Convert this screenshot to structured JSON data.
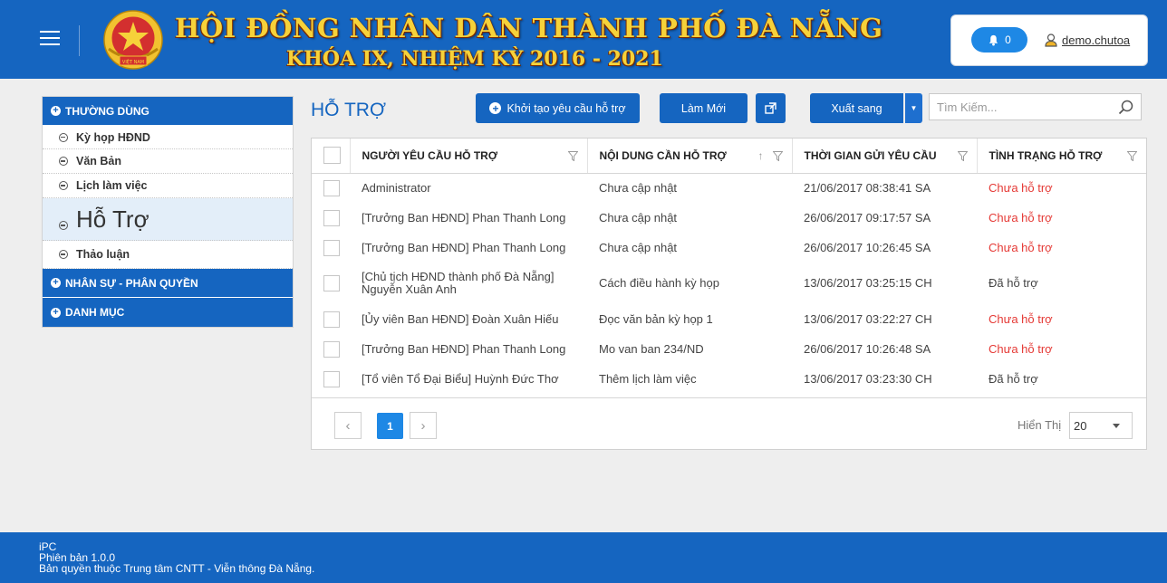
{
  "header": {
    "title_line1": "HỘI ĐỒNG NHÂN DÂN THÀNH PHỐ ĐÀ NẴNG",
    "title_line2": "KHÓA IX, NHIỆM KỲ 2016 - 2021",
    "notification_count": "0",
    "username": "demo.chutoa",
    "emblem_text": "VIỆT NAM"
  },
  "sidebar": {
    "sections": [
      {
        "label": "THƯỜNG DÙNG"
      },
      {
        "label": "NHÂN SỰ - PHÂN QUYỀN"
      },
      {
        "label": "DANH MỤC"
      }
    ],
    "items": [
      {
        "label": "Kỳ họp HĐND"
      },
      {
        "label": "Văn Bản"
      },
      {
        "label": "Lịch làm việc"
      },
      {
        "label": "Hỗ Trợ"
      },
      {
        "label": "Thảo luận"
      }
    ]
  },
  "main": {
    "title": "HỖ TRỢ",
    "create_label": "Khởi tạo yêu cầu hỗ trợ",
    "refresh_label": "Làm Mới",
    "export_label": "Xuất sang",
    "search_placeholder": "Tìm Kiếm..."
  },
  "table": {
    "columns": [
      "NGƯỜI YÊU CẦU HỖ TRỢ",
      "NỘI DUNG CẦN HỖ TRỢ",
      "THỜI GIAN GỬI YÊU CẦU",
      "TÌNH TRẠNG HỖ TRỢ"
    ],
    "rows": [
      {
        "requester": "Administrator",
        "content": "Chưa cập nhật",
        "time": "21/06/2017 08:38:41 SA",
        "status": "Chưa hỗ trợ"
      },
      {
        "requester": "[Trưởng Ban HĐND] Phan Thanh Long",
        "content": "Chưa cập nhật",
        "time": "26/06/2017 09:17:57 SA",
        "status": "Chưa hỗ trợ"
      },
      {
        "requester": "[Trưởng Ban HĐND] Phan Thanh Long",
        "content": "Chưa cập nhật",
        "time": "26/06/2017 10:26:45 SA",
        "status": "Chưa hỗ trợ"
      },
      {
        "requester": "[Chủ tịch HĐND thành phố Đà Nẵng] Nguyễn Xuân Anh",
        "content": "Cách điều hành kỳ họp",
        "time": "13/06/2017 03:25:15 CH",
        "status": "Đã hỗ trợ"
      },
      {
        "requester": "[Ủy viên Ban HĐND] Đoàn Xuân Hiếu",
        "content": "Đọc văn bản kỳ họp 1",
        "time": "13/06/2017 03:22:27 CH",
        "status": "Chưa hỗ trợ"
      },
      {
        "requester": "[Trưởng Ban HĐND] Phan Thanh Long",
        "content": "Mo van ban 234/ND",
        "time": "26/06/2017 10:26:48 SA",
        "status": "Chưa hỗ trợ"
      },
      {
        "requester": "[Tổ viên Tổ Đại Biểu] Huỳnh Đức Thơ",
        "content": "Thêm lịch làm việc",
        "time": "13/06/2017 03:23:30 CH",
        "status": "Đã hỗ trợ"
      }
    ],
    "status_colors": {
      "pending": "#e53935",
      "done": "#444444"
    }
  },
  "pager": {
    "current_page": "1",
    "show_label": "Hiển Thị",
    "page_size": "20"
  },
  "footer": {
    "line1": "iPC",
    "line2": "Phiên bản 1.0.0",
    "line3": "Bản quyền thuộc Trung tâm CNTT - Viễn thông Đà Nẵng."
  },
  "colors": {
    "primary": "#1565c0",
    "accent": "#1e88e5",
    "title_gold": "#f6d23a"
  }
}
